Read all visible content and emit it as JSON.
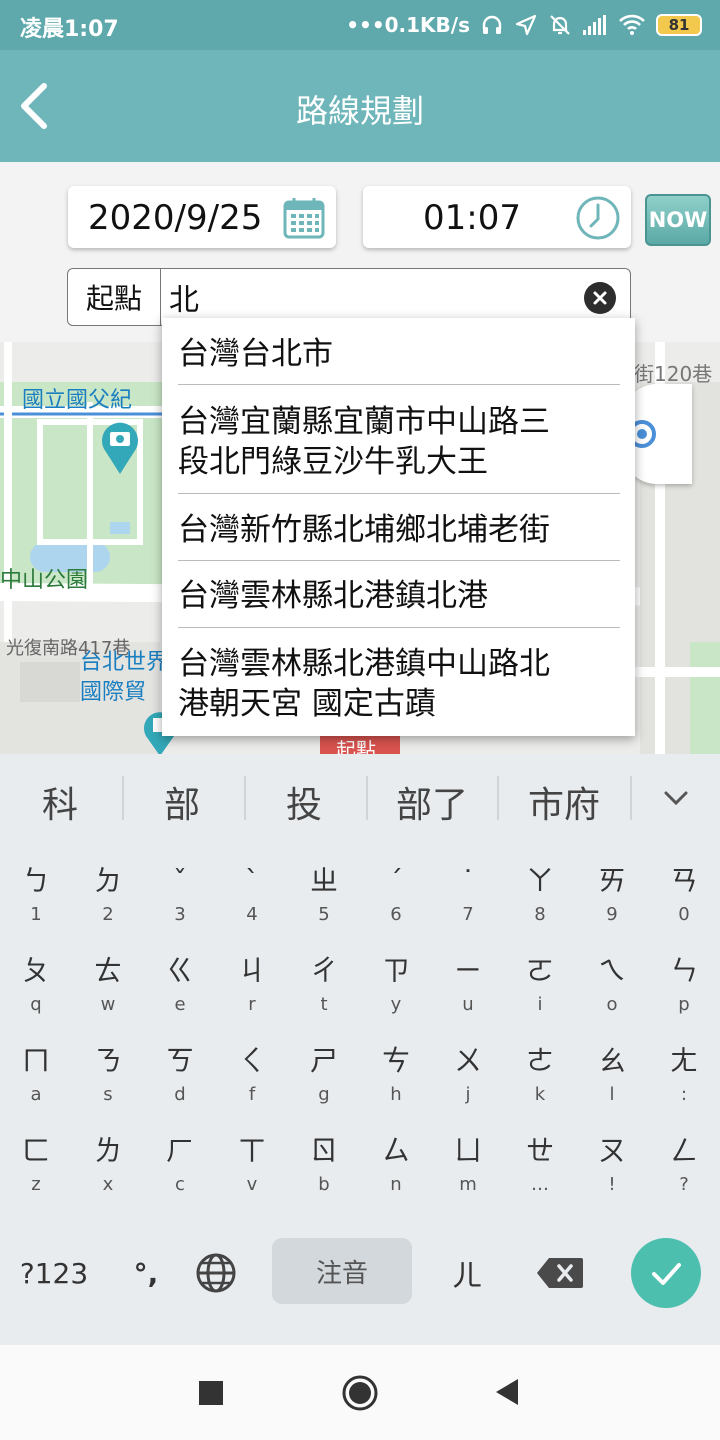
{
  "status_bar": {
    "time": "凌晨1:07",
    "net_speed": "•••0.1KB/s",
    "battery": "81"
  },
  "app_bar": {
    "title": "路線規劃"
  },
  "controls": {
    "date": "2020/9/25",
    "time": "01:07",
    "now_label": "NOW",
    "start_label": "起點",
    "search_value": "北"
  },
  "map": {
    "labels": [
      "國立國父紀",
      "中山公園",
      "光復南路417巷",
      "台北世界",
      "國際貿",
      "街120巷",
      "起點"
    ]
  },
  "suggestions": [
    {
      "line1": "台灣台北市",
      "line2": ""
    },
    {
      "line1": "台灣宜蘭縣宜蘭市中山路三",
      "line2": "段北門綠豆沙牛乳大王"
    },
    {
      "line1": "台灣新竹縣北埔鄉北埔老街",
      "line2": ""
    },
    {
      "line1": "台灣雲林縣北港鎮北港",
      "line2": ""
    },
    {
      "line1": "台灣雲林縣北港鎮中山路北",
      "line2": "港朝天宮 國定古蹟"
    }
  ],
  "ime_candidates": [
    "科",
    "部",
    "投",
    "部了",
    "市府"
  ],
  "keyboard": {
    "rows": [
      [
        [
          "ㄅ",
          "1"
        ],
        [
          "ㄉ",
          "2"
        ],
        [
          "ˇ",
          "3"
        ],
        [
          "ˋ",
          "4"
        ],
        [
          "ㄓ",
          "5"
        ],
        [
          "ˊ",
          "6"
        ],
        [
          "˙",
          "7"
        ],
        [
          "ㄚ",
          "8"
        ],
        [
          "ㄞ",
          "9"
        ],
        [
          "ㄢ",
          "0"
        ]
      ],
      [
        [
          "ㄆ",
          "q"
        ],
        [
          "ㄊ",
          "w"
        ],
        [
          "ㄍ",
          "e"
        ],
        [
          "ㄐ",
          "r"
        ],
        [
          "ㄔ",
          "t"
        ],
        [
          "ㄗ",
          "y"
        ],
        [
          "ㄧ",
          "u"
        ],
        [
          "ㄛ",
          "i"
        ],
        [
          "ㄟ",
          "o"
        ],
        [
          "ㄣ",
          "p"
        ]
      ],
      [
        [
          "ㄇ",
          "a"
        ],
        [
          "ㄋ",
          "s"
        ],
        [
          "ㄎ",
          "d"
        ],
        [
          "ㄑ",
          "f"
        ],
        [
          "ㄕ",
          "g"
        ],
        [
          "ㄘ",
          "h"
        ],
        [
          "ㄨ",
          "j"
        ],
        [
          "ㄜ",
          "k"
        ],
        [
          "ㄠ",
          "l"
        ],
        [
          "ㄤ",
          ":"
        ]
      ],
      [
        [
          "ㄈ",
          "z"
        ],
        [
          "ㄌ",
          "x"
        ],
        [
          "ㄏ",
          "c"
        ],
        [
          "ㄒ",
          "v"
        ],
        [
          "ㄖ",
          "b"
        ],
        [
          "ㄙ",
          "n"
        ],
        [
          "ㄩ",
          "m"
        ],
        [
          "ㄝ",
          "…"
        ],
        [
          "ㄡ",
          "!"
        ],
        [
          "ㄥ",
          "?"
        ]
      ]
    ],
    "symbols_label": "?123",
    "punct_label": "°,",
    "space_label": "注音",
    "er_label": "ㄦ"
  },
  "colors": {
    "accent": "#6fb6ba",
    "status_bar": "#5fa9ad",
    "enter": "#4dbfae"
  }
}
